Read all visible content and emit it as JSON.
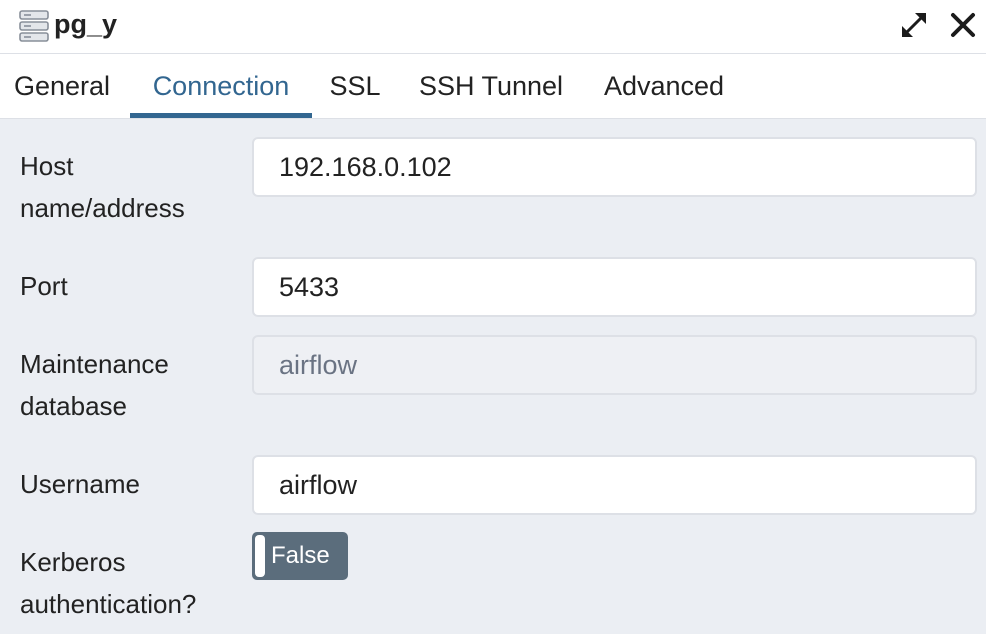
{
  "dialog": {
    "title": "pg_y",
    "icon": "server-icon"
  },
  "titlebar_buttons": {
    "expand_icon": "expand-icon",
    "close_icon": "close-icon"
  },
  "tabs": [
    {
      "label": "General",
      "active": false
    },
    {
      "label": "Connection",
      "active": true
    },
    {
      "label": "SSL",
      "active": false
    },
    {
      "label": "SSH Tunnel",
      "active": false
    },
    {
      "label": "Advanced",
      "active": false
    }
  ],
  "form": {
    "host": {
      "label_line1": "Host",
      "label_line2": "name/address",
      "value": "192.168.0.102"
    },
    "port": {
      "label": "Port",
      "value": "5433"
    },
    "maintenance_db": {
      "label_line1": "Maintenance",
      "label_line2": "database",
      "value": "airflow",
      "disabled": true
    },
    "username": {
      "label": "Username",
      "value": "airflow"
    },
    "kerberos": {
      "label_line1": "Kerberos",
      "label_line2": "authentication?",
      "value_label": "False"
    }
  },
  "colors": {
    "accent": "#326690",
    "panel_background": "#ebeef3",
    "toggle_off": "#5b6d7c"
  }
}
